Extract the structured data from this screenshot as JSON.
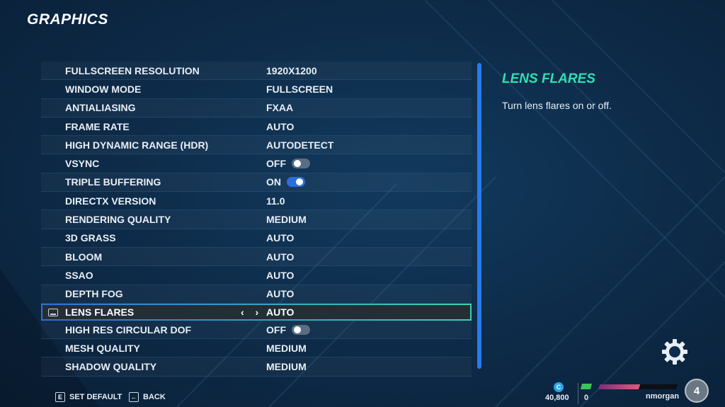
{
  "page": {
    "title": "GRAPHICS"
  },
  "settings": [
    {
      "label": "FULLSCREEN RESOLUTION",
      "value": "1920X1200"
    },
    {
      "label": "WINDOW MODE",
      "value": "FULLSCREEN"
    },
    {
      "label": "ANTIALIASING",
      "value": "FXAA"
    },
    {
      "label": "FRAME RATE",
      "value": "AUTO"
    },
    {
      "label": "HIGH DYNAMIC RANGE (HDR)",
      "value": "AUTODETECT"
    },
    {
      "label": "VSYNC",
      "value": "OFF",
      "toggle": "off"
    },
    {
      "label": "TRIPLE BUFFERING",
      "value": "ON",
      "toggle": "on"
    },
    {
      "label": "DIRECTX VERSION",
      "value": "11.0"
    },
    {
      "label": "RENDERING QUALITY",
      "value": "MEDIUM"
    },
    {
      "label": "3D GRASS",
      "value": "AUTO"
    },
    {
      "label": "BLOOM",
      "value": "AUTO"
    },
    {
      "label": "SSAO",
      "value": "AUTO"
    },
    {
      "label": "DEPTH FOG",
      "value": "AUTO"
    },
    {
      "label": "LENS FLARES",
      "value": "AUTO",
      "selected": true,
      "arrows": "‹ ›"
    },
    {
      "label": "HIGH RES CIRCULAR DOF",
      "value": "OFF",
      "toggle": "off"
    },
    {
      "label": "MESH QUALITY",
      "value": "MEDIUM"
    },
    {
      "label": "SHADOW QUALITY",
      "value": "MEDIUM"
    }
  ],
  "description": {
    "title": "LENS FLARES",
    "text": "Turn lens flares on or off."
  },
  "footer": {
    "set_default_key": "E",
    "set_default_label": "SET DEFAULT",
    "back_key": "←",
    "back_label": "BACK"
  },
  "hud": {
    "currency_icon": "C",
    "currency_value": "40,800",
    "flag_value": "0",
    "level_progress": 0.52,
    "username": "nmorgan",
    "level": "4"
  },
  "colors": {
    "accent_teal": "#2fe0b0",
    "toggle_on": "#2b6ee0",
    "scrollbar": "#2a7ae8"
  }
}
